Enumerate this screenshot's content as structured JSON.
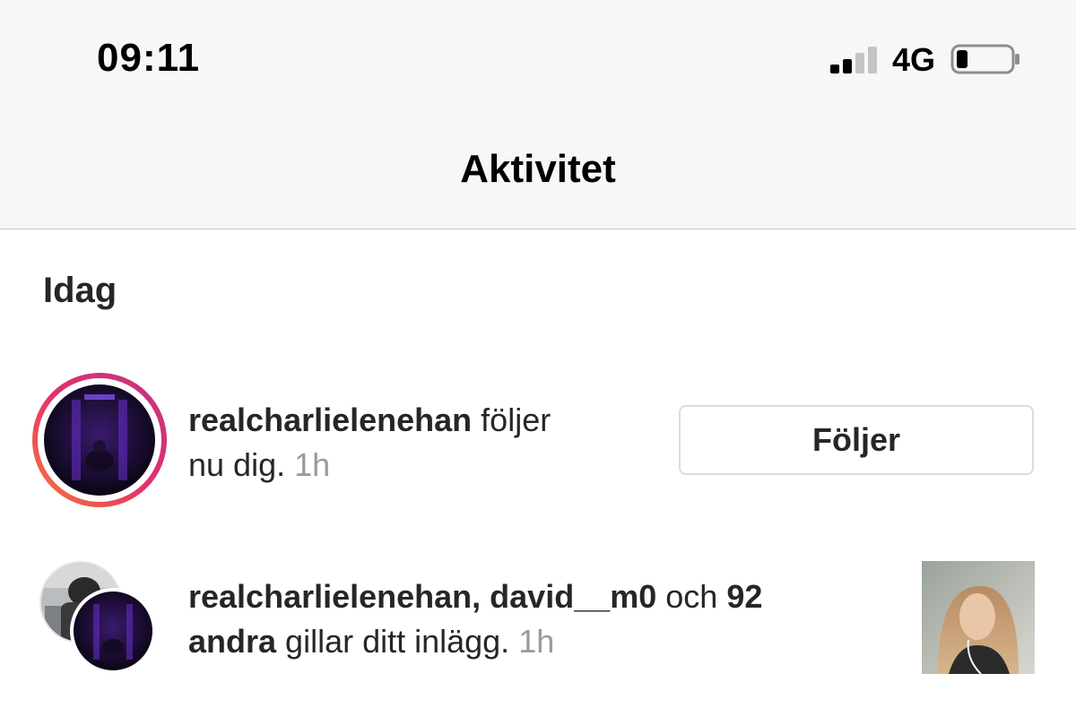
{
  "status_bar": {
    "time": "09:11",
    "network": "4G",
    "signal_bars_active": 2,
    "signal_bars_total": 4,
    "battery_level": 0.2
  },
  "header": {
    "title": "Aktivitet"
  },
  "section": {
    "label": "Idag"
  },
  "notifications": [
    {
      "user": "realcharlielenehan",
      "action": " följer",
      "line2": "nu dig.",
      "time": " 1h",
      "button_label": "Följer"
    },
    {
      "users": "realcharlielenehan, david__m0",
      "connector": " och ",
      "count": "92",
      "others": "andra",
      "action": " gillar ditt inlägg.",
      "time": " 1h"
    }
  ],
  "colors": {
    "accent_ring_start": "#c13584",
    "accent_ring_end": "#f77737",
    "text_primary": "#262626",
    "text_muted": "#9a9a9a",
    "border": "#dbdbdb"
  },
  "icons": {
    "signal": "cellular-signal-icon",
    "battery": "battery-icon",
    "story_ring": "story-ring-icon"
  }
}
